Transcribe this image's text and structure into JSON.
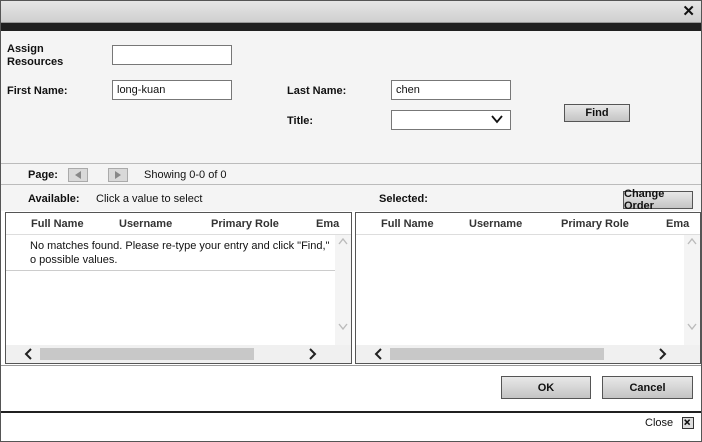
{
  "window": {
    "close_glyph": "✕"
  },
  "form": {
    "assign_resources_label": "Assign Resources",
    "assign_resources_value": "",
    "first_name_label": "First Name:",
    "first_name_value": "long-kuan",
    "last_name_label": "Last Name:",
    "last_name_value": "chen",
    "title_label": "Title:",
    "title_value": "",
    "find_label": "Find"
  },
  "pager": {
    "page_label": "Page:",
    "showing_text": "Showing 0-0 of 0"
  },
  "available": {
    "label": "Available:",
    "hint": "Click a value to select",
    "columns": [
      "Full Name",
      "Username",
      "Primary Role",
      "Ema"
    ],
    "empty_message": "No matches found. Please re-type your entry and click \"Find,\" o possible values."
  },
  "selected": {
    "label": "Selected:",
    "change_order_label": "Change Order",
    "columns": [
      "Full Name",
      "Username",
      "Primary Role",
      "Ema"
    ]
  },
  "actions": {
    "ok_label": "OK",
    "cancel_label": "Cancel"
  },
  "footer": {
    "close_label": "Close"
  },
  "icons": {
    "window_close": "close-icon",
    "prev_page": "triangle-left-icon",
    "next_page": "triangle-right-icon",
    "dropdown": "chevron-down-icon",
    "scroll_up": "chevron-up-icon",
    "scroll_down": "chevron-down-icon",
    "scroll_left": "chevron-left-icon",
    "scroll_right": "chevron-right-icon",
    "footer_close": "close-box-icon"
  },
  "colors": {
    "dark_bar": "#202020",
    "panel_bg": "#f4f4f4",
    "button_face": "#c4c4c4"
  }
}
